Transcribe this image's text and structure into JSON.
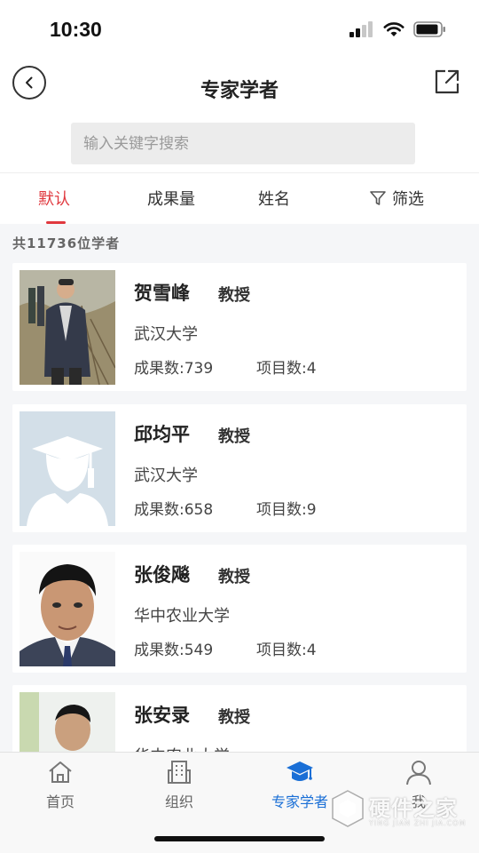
{
  "status_bar": {
    "time": "10:30"
  },
  "header": {
    "title": "专家学者"
  },
  "search": {
    "placeholder": "输入关键字搜索"
  },
  "sort_tabs": {
    "items": [
      {
        "label": "默认"
      },
      {
        "label": "成果量"
      },
      {
        "label": "姓名"
      }
    ],
    "filter_label": "筛选",
    "active_color": "#e0383e"
  },
  "list": {
    "count_text": "共11736位学者",
    "scholars": [
      {
        "name": "贺雪峰",
        "title": "教授",
        "org": "武汉大学",
        "achievements": "成果数:739",
        "projects": "项目数:4"
      },
      {
        "name": "邱均平",
        "title": "教授",
        "org": "武汉大学",
        "achievements": "成果数:658",
        "projects": "项目数:9"
      },
      {
        "name": "张俊飚",
        "title": "教授",
        "org": "华中农业大学",
        "achievements": "成果数:549",
        "projects": "项目数:4"
      },
      {
        "name": "张安录",
        "title": "教授",
        "org": "华中农业大学"
      }
    ]
  },
  "tabbar": {
    "items": [
      {
        "label": "首页",
        "icon": "home-icon"
      },
      {
        "label": "组织",
        "icon": "building-icon"
      },
      {
        "label": "专家学者",
        "icon": "graduation-cap-icon"
      },
      {
        "label": "我",
        "icon": "user-icon"
      }
    ],
    "active_color": "#1a6fd6"
  },
  "watermark": {
    "text": "硬件之家",
    "sub": "YING JIAN ZHI JIA.COM"
  }
}
